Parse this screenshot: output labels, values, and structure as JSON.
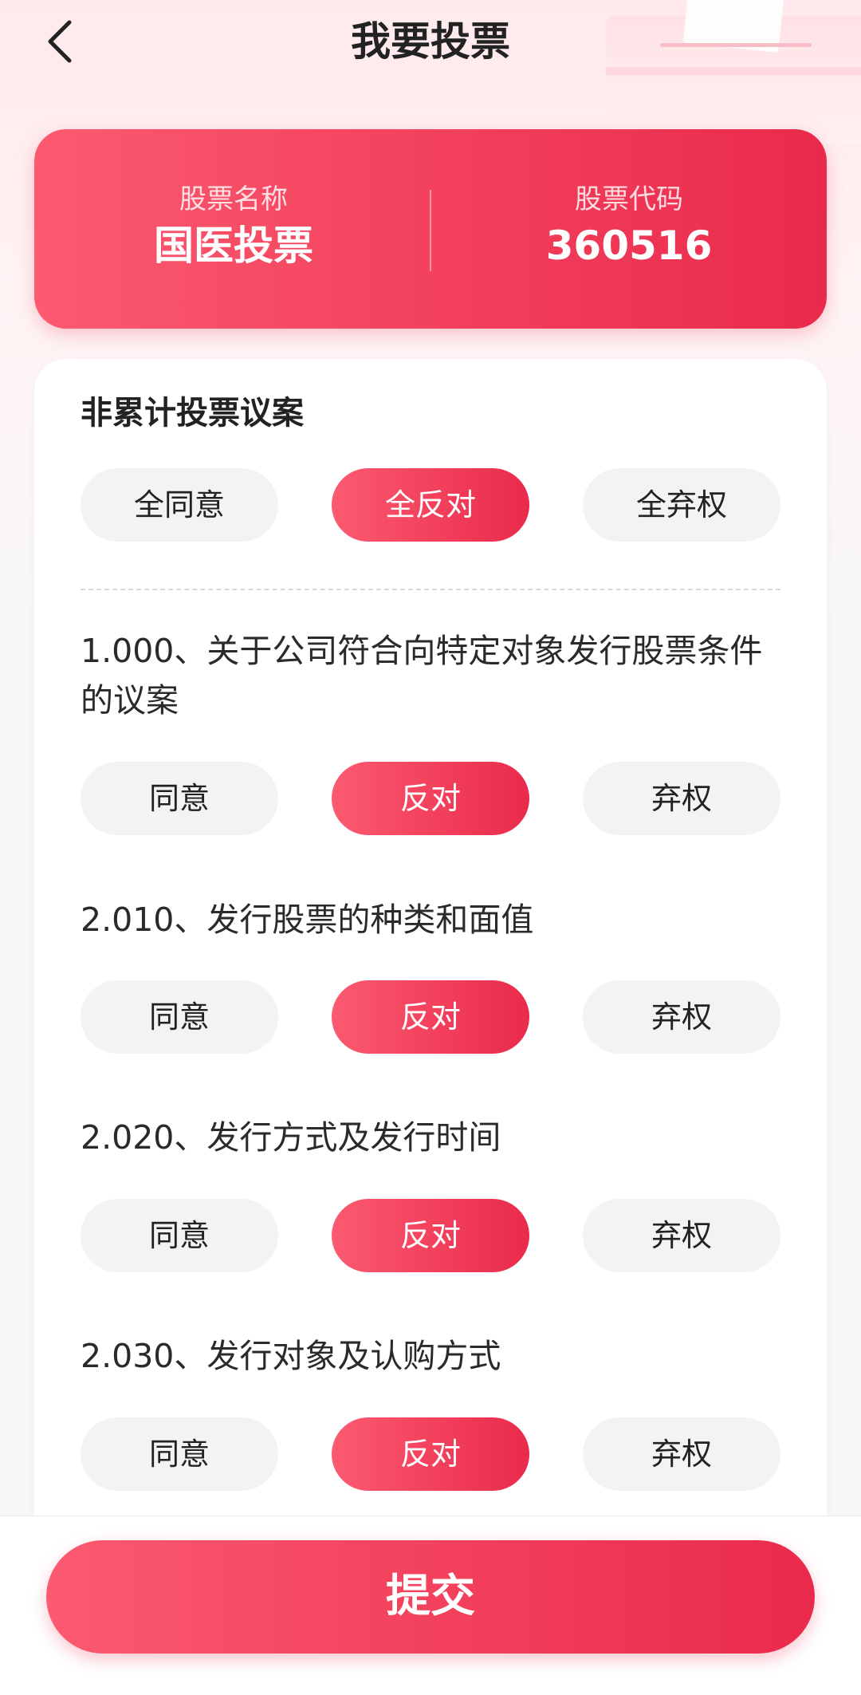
{
  "header": {
    "title": "我要投票",
    "back_icon": "chevron-left-icon"
  },
  "stock": {
    "name_label": "股票名称",
    "name_value": "国医投票",
    "code_label": "股票代码",
    "code_value": "360516"
  },
  "section": {
    "title": "非累计投票议案",
    "bulk_options": [
      "全同意",
      "全反对",
      "全弃权"
    ],
    "bulk_selected": "全反对"
  },
  "proposals": [
    {
      "text": "1.000、关于公司符合向特定对象发行股票条件的议案",
      "options": [
        "同意",
        "反对",
        "弃权"
      ],
      "selected": "反对"
    },
    {
      "text": "2.010、发行股票的种类和面值",
      "options": [
        "同意",
        "反对",
        "弃权"
      ],
      "selected": "反对"
    },
    {
      "text": "2.020、发行方式及发行时间",
      "options": [
        "同意",
        "反对",
        "弃权"
      ],
      "selected": "反对"
    },
    {
      "text": "2.030、发行对象及认购方式",
      "options": [
        "同意",
        "反对",
        "弃权"
      ],
      "selected": "反对"
    }
  ],
  "footer": {
    "submit_label": "提交"
  },
  "colors": {
    "accent_start": "#fb5a70",
    "accent_end": "#ea2a4c",
    "pill_inactive": "#f3f3f3"
  }
}
